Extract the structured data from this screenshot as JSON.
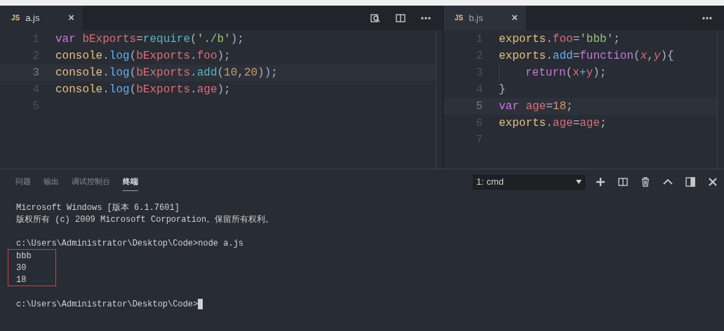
{
  "editors": [
    {
      "tab": {
        "icon": "JS",
        "label": "a.js",
        "close": "×",
        "selected": true
      },
      "lines": [
        {
          "number": "1",
          "highlighted": false,
          "tokens": [
            {
              "t": "var ",
              "kind": "keyword"
            },
            {
              "t": "bExports",
              "kind": "variable"
            },
            {
              "t": "=",
              "kind": "punct"
            },
            {
              "t": "require",
              "kind": "builtin"
            },
            {
              "t": "(",
              "kind": "punct"
            },
            {
              "t": "'./b'",
              "kind": "string"
            },
            {
              "t": ");",
              "kind": "punct"
            }
          ]
        },
        {
          "number": "2",
          "highlighted": false,
          "tokens": [
            {
              "t": "console",
              "kind": "object"
            },
            {
              "t": ".",
              "kind": "punct"
            },
            {
              "t": "log",
              "kind": "function"
            },
            {
              "t": "(",
              "kind": "punct"
            },
            {
              "t": "bExports",
              "kind": "variable"
            },
            {
              "t": ".",
              "kind": "punct"
            },
            {
              "t": "foo",
              "kind": "variable"
            },
            {
              "t": ");",
              "kind": "punct"
            }
          ]
        },
        {
          "number": "3",
          "highlighted": true,
          "tokens": [
            {
              "t": "console",
              "kind": "object"
            },
            {
              "t": ".",
              "kind": "punct"
            },
            {
              "t": "log",
              "kind": "function"
            },
            {
              "t": "(",
              "kind": "punct"
            },
            {
              "t": "bExports",
              "kind": "variable"
            },
            {
              "t": ".",
              "kind": "punct"
            },
            {
              "t": "add",
              "kind": "builtin"
            },
            {
              "t": "(",
              "kind": "punct"
            },
            {
              "t": "10",
              "kind": "number"
            },
            {
              "t": ",",
              "kind": "punct"
            },
            {
              "t": "20",
              "kind": "number"
            },
            {
              "t": "));",
              "kind": "punct"
            }
          ]
        },
        {
          "number": "4",
          "highlighted": false,
          "tokens": [
            {
              "t": "console",
              "kind": "object"
            },
            {
              "t": ".",
              "kind": "punct"
            },
            {
              "t": "log",
              "kind": "function"
            },
            {
              "t": "(",
              "kind": "punct"
            },
            {
              "t": "bExports",
              "kind": "variable"
            },
            {
              "t": ".",
              "kind": "punct"
            },
            {
              "t": "age",
              "kind": "variable"
            },
            {
              "t": ");",
              "kind": "punct"
            }
          ]
        },
        {
          "number": "5",
          "highlighted": false
        }
      ]
    },
    {
      "tab": {
        "icon": "JS",
        "label": "b.js",
        "close": "×",
        "selected": false
      },
      "lines": [
        {
          "number": "1",
          "highlighted": false,
          "tokens": [
            {
              "t": "exports",
              "kind": "object"
            },
            {
              "t": ".",
              "kind": "punct"
            },
            {
              "t": "foo",
              "kind": "variable"
            },
            {
              "t": "=",
              "kind": "punct"
            },
            {
              "t": "'bbb'",
              "kind": "string"
            },
            {
              "t": ";",
              "kind": "punct"
            }
          ]
        },
        {
          "number": "2",
          "highlighted": false,
          "tokens": [
            {
              "t": "exports",
              "kind": "object"
            },
            {
              "t": ".",
              "kind": "punct"
            },
            {
              "t": "add",
              "kind": "function"
            },
            {
              "t": "=",
              "kind": "punct"
            },
            {
              "t": "function",
              "kind": "keyword"
            },
            {
              "t": "(",
              "kind": "punct"
            },
            {
              "t": "x",
              "kind": "param"
            },
            {
              "t": ",",
              "kind": "punct"
            },
            {
              "t": "y",
              "kind": "param"
            },
            {
              "t": "){",
              "kind": "punct"
            }
          ]
        },
        {
          "number": "3",
          "highlighted": false,
          "indented": true,
          "tokens": [
            {
              "t": "return",
              "kind": "keyword"
            },
            {
              "t": "(",
              "kind": "punct"
            },
            {
              "t": "x",
              "kind": "variable"
            },
            {
              "t": "+",
              "kind": "builtin"
            },
            {
              "t": "y",
              "kind": "variable"
            },
            {
              "t": ");",
              "kind": "punct"
            }
          ]
        },
        {
          "number": "4",
          "highlighted": false,
          "tokens": [
            {
              "t": "}",
              "kind": "punct"
            }
          ]
        },
        {
          "number": "5",
          "highlighted": true,
          "tokens": [
            {
              "t": "var ",
              "kind": "keyword"
            },
            {
              "t": "age",
              "kind": "variable"
            },
            {
              "t": "=",
              "kind": "punct"
            },
            {
              "t": "18",
              "kind": "number"
            },
            {
              "t": ";",
              "kind": "punct"
            }
          ]
        },
        {
          "number": "6",
          "highlighted": false,
          "tokens": [
            {
              "t": "exports",
              "kind": "object"
            },
            {
              "t": ".",
              "kind": "punct"
            },
            {
              "t": "age",
              "kind": "variable"
            },
            {
              "t": "=",
              "kind": "punct"
            },
            {
              "t": "age",
              "kind": "variable"
            },
            {
              "t": ";",
              "kind": "punct"
            }
          ]
        },
        {
          "number": "7",
          "highlighted": false
        }
      ]
    }
  ],
  "panel": {
    "tabs": [
      {
        "label": "问题",
        "selected": false
      },
      {
        "label": "输出",
        "selected": false
      },
      {
        "label": "调试控制台",
        "selected": false
      },
      {
        "label": "终端",
        "selected": true
      }
    ],
    "terminal_select": {
      "value": "1: cmd"
    },
    "terminal": [
      {
        "text": "Microsoft Windows [版本 6.1.7601]",
        "boxed": false,
        "cursor": false
      },
      {
        "text": "版权所有 (c) 2009 Microsoft Corporation。保留所有权利。",
        "boxed": false,
        "cursor": false
      },
      {
        "text": "c:\\Users\\Administrator\\Desktop\\Code>node a.js",
        "blank_before": true,
        "boxed": false,
        "cursor": false
      },
      {
        "text": "bbb",
        "boxed": true,
        "cursor": false
      },
      {
        "text": "30",
        "boxed": true,
        "cursor": false
      },
      {
        "text": "18",
        "boxed": true,
        "cursor": false
      },
      {
        "text": "c:\\Users\\Administrator\\Desktop\\Code>",
        "blank_before": true,
        "boxed": false,
        "cursor": true
      }
    ]
  }
}
